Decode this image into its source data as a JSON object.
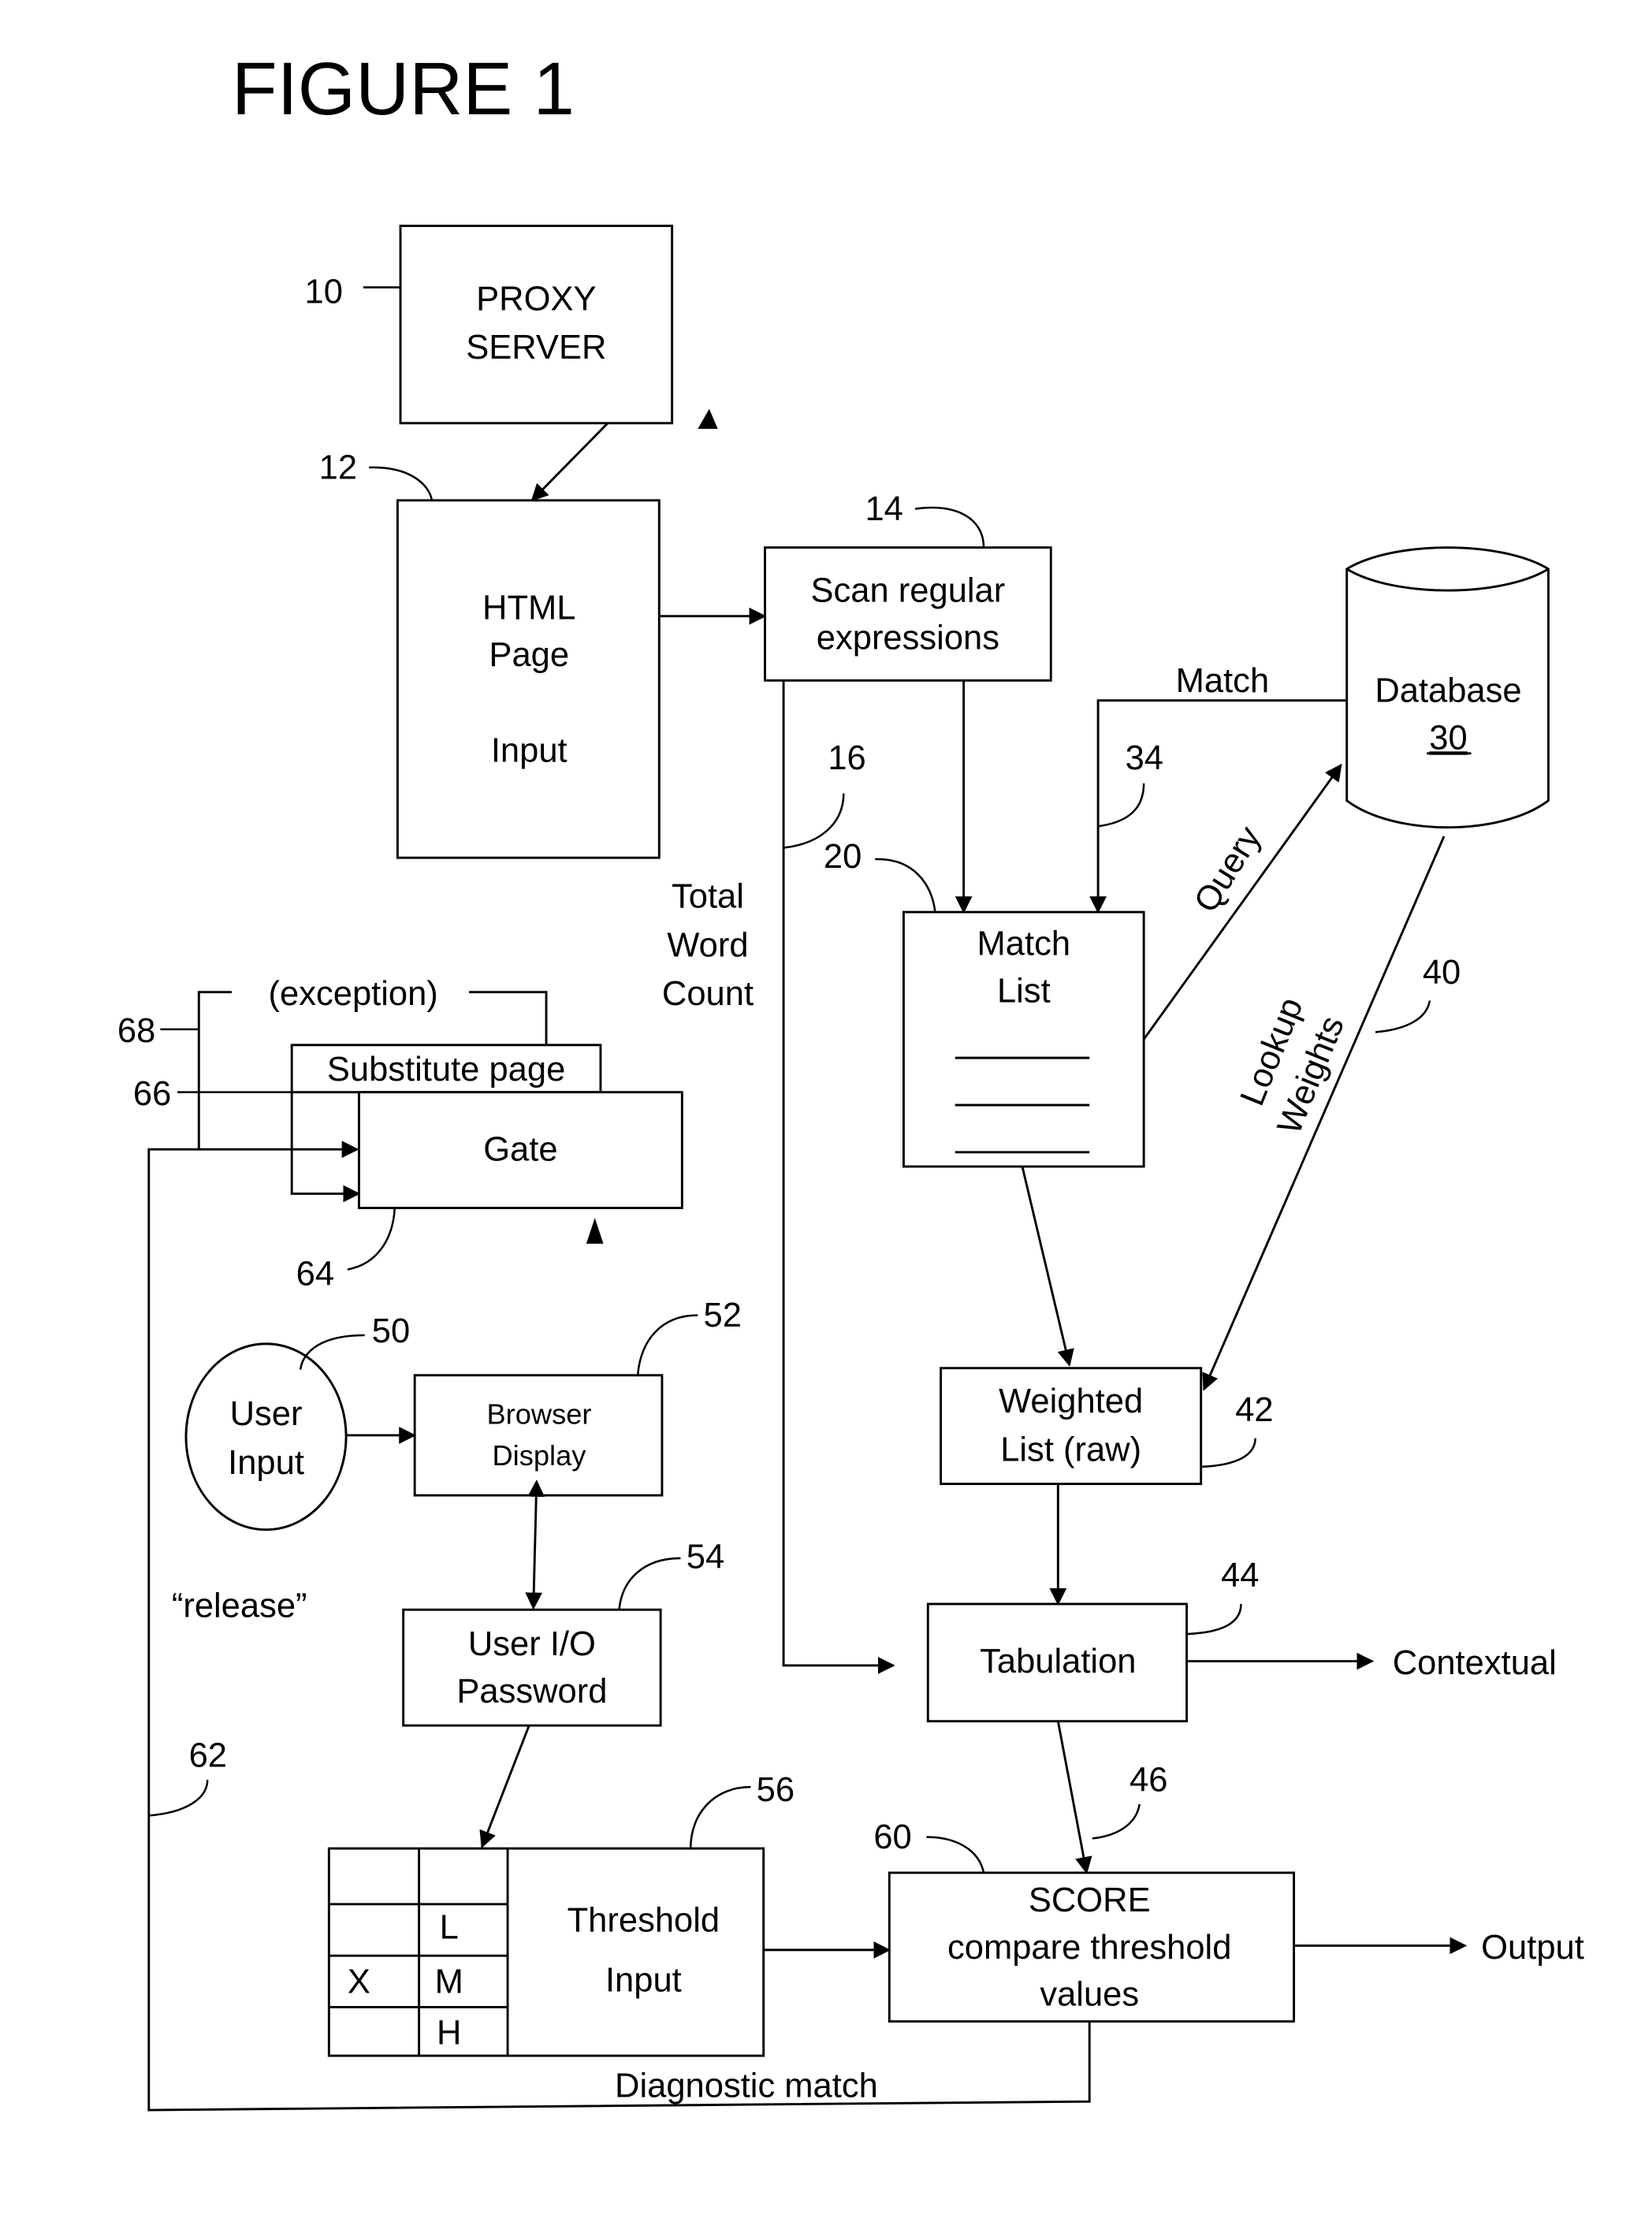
{
  "figure": {
    "title": "FIGURE 1",
    "colors": {
      "ink": "#000000",
      "background": "#ffffff"
    }
  },
  "nodes": {
    "proxy_server": {
      "ref": "10",
      "lines": [
        "PROXY",
        "SERVER"
      ]
    },
    "html_page": {
      "ref": "12",
      "lines": [
        "HTML",
        "Page",
        "Input"
      ]
    },
    "scan": {
      "ref": "14",
      "lines": [
        "Scan regular",
        "expressions"
      ]
    },
    "database": {
      "ref": "30",
      "lines": [
        "Database",
        "30"
      ]
    },
    "match_list": {
      "ref": "20",
      "lines": [
        "Match",
        "List"
      ]
    },
    "weighted_list": {
      "ref": "42",
      "lines": [
        "Weighted",
        "List (raw)"
      ]
    },
    "tabulation": {
      "ref": "44",
      "lines": [
        "Tabulation"
      ]
    },
    "score": {
      "ref": "60",
      "lines": [
        "SCORE",
        "compare threshold",
        "values"
      ]
    },
    "gate": {
      "ref": "64",
      "lines": [
        "Gate"
      ]
    },
    "substitute_page": {
      "ref": "66",
      "lines": [
        "Substitute page"
      ]
    },
    "user_input": {
      "ref": "50",
      "lines": [
        "User",
        "Input"
      ]
    },
    "browser_display": {
      "ref": "52",
      "lines": [
        "Browser",
        "Display"
      ]
    },
    "user_io": {
      "ref": "54",
      "lines": [
        "User I/O",
        "Password"
      ]
    },
    "threshold_input": {
      "ref": "56",
      "lines": [
        "Threshold",
        "Input"
      ],
      "grid": [
        [
          "",
          ""
        ],
        [
          "",
          "L"
        ],
        [
          "X",
          "M"
        ],
        [
          "",
          "H"
        ]
      ]
    }
  },
  "edge_labels": {
    "match": "Match",
    "query": "Query",
    "lookup_weights": [
      "Lookup",
      "Weights"
    ],
    "total_word_count": [
      "Total",
      "Word",
      "Count"
    ],
    "contextual": "Contextual",
    "output": "Output",
    "diagnostic_match": "Diagnostic match",
    "release": "“release”",
    "exception": "(exception)"
  },
  "refs": {
    "r10": "10",
    "r12": "12",
    "r14": "14",
    "r16": "16",
    "r20": "20",
    "r34": "34",
    "r40": "40",
    "r42": "42",
    "r44": "44",
    "r46": "46",
    "r50": "50",
    "r52": "52",
    "r54": "54",
    "r56": "56",
    "r60": "60",
    "r62": "62",
    "r64": "64",
    "r66": "66",
    "r68": "68"
  }
}
